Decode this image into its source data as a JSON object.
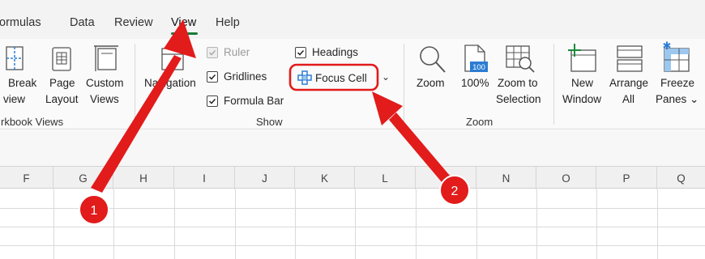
{
  "tabs": {
    "formulas": "ormulas",
    "data": "Data",
    "review": "Review",
    "view": "View",
    "help": "Help"
  },
  "workbook_views": {
    "break_line1": "Break",
    "break_line2": "view",
    "page_layout_line1": "Page",
    "page_layout_line2": "Layout",
    "custom_views_line1": "Custom",
    "custom_views_line2": "Views",
    "group_title": "rkbook Views"
  },
  "show": {
    "navigation": "Navigation",
    "ruler": "Ruler",
    "gridlines": "Gridlines",
    "formula_bar": "Formula Bar",
    "headings": "Headings",
    "focus_cell": "Focus Cell",
    "group_title": "Show"
  },
  "zoom": {
    "zoom": "Zoom",
    "hundred": "100%",
    "hundred_icon_text": "100",
    "zoom_to_line1": "Zoom to",
    "zoom_to_line2": "Selection",
    "group_title": "Zoom"
  },
  "window": {
    "new_line1": "New",
    "new_line2": "Window",
    "arrange_line1": "Arrange",
    "arrange_line2": "All",
    "freeze_line1": "Freeze",
    "freeze_line2": "Panes ⌄"
  },
  "columns": [
    "F",
    "G",
    "H",
    "I",
    "J",
    "K",
    "L",
    "M",
    "N",
    "O",
    "P",
    "Q"
  ],
  "callouts": [
    "1",
    "2"
  ],
  "colors": {
    "accent_green": "#1a7a3a",
    "callout_red": "#e21b1b",
    "icon_blue": "#2b7cd3"
  }
}
